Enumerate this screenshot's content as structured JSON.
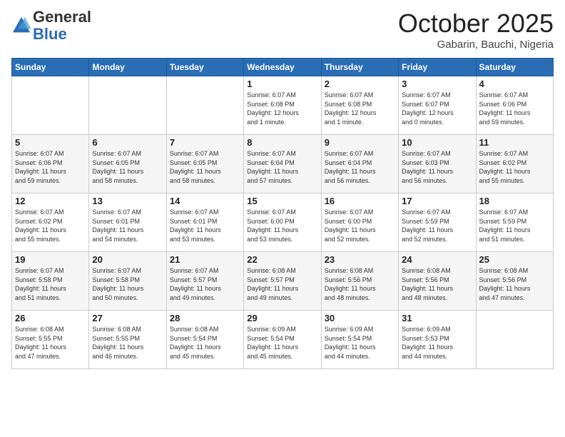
{
  "header": {
    "logo_general": "General",
    "logo_blue": "Blue",
    "month": "October 2025",
    "location": "Gabarin, Bauchi, Nigeria"
  },
  "weekdays": [
    "Sunday",
    "Monday",
    "Tuesday",
    "Wednesday",
    "Thursday",
    "Friday",
    "Saturday"
  ],
  "weeks": [
    [
      {
        "day": "",
        "info": ""
      },
      {
        "day": "",
        "info": ""
      },
      {
        "day": "",
        "info": ""
      },
      {
        "day": "1",
        "info": "Sunrise: 6:07 AM\nSunset: 6:08 PM\nDaylight: 12 hours\nand 1 minute."
      },
      {
        "day": "2",
        "info": "Sunrise: 6:07 AM\nSunset: 6:08 PM\nDaylight: 12 hours\nand 1 minute."
      },
      {
        "day": "3",
        "info": "Sunrise: 6:07 AM\nSunset: 6:07 PM\nDaylight: 12 hours\nand 0 minutes."
      },
      {
        "day": "4",
        "info": "Sunrise: 6:07 AM\nSunset: 6:06 PM\nDaylight: 11 hours\nand 59 minutes."
      }
    ],
    [
      {
        "day": "5",
        "info": "Sunrise: 6:07 AM\nSunset: 6:06 PM\nDaylight: 11 hours\nand 59 minutes."
      },
      {
        "day": "6",
        "info": "Sunrise: 6:07 AM\nSunset: 6:05 PM\nDaylight: 11 hours\nand 58 minutes."
      },
      {
        "day": "7",
        "info": "Sunrise: 6:07 AM\nSunset: 6:05 PM\nDaylight: 11 hours\nand 58 minutes."
      },
      {
        "day": "8",
        "info": "Sunrise: 6:07 AM\nSunset: 6:04 PM\nDaylight: 11 hours\nand 57 minutes."
      },
      {
        "day": "9",
        "info": "Sunrise: 6:07 AM\nSunset: 6:04 PM\nDaylight: 11 hours\nand 56 minutes."
      },
      {
        "day": "10",
        "info": "Sunrise: 6:07 AM\nSunset: 6:03 PM\nDaylight: 11 hours\nand 56 minutes."
      },
      {
        "day": "11",
        "info": "Sunrise: 6:07 AM\nSunset: 6:02 PM\nDaylight: 11 hours\nand 55 minutes."
      }
    ],
    [
      {
        "day": "12",
        "info": "Sunrise: 6:07 AM\nSunset: 6:02 PM\nDaylight: 11 hours\nand 55 minutes."
      },
      {
        "day": "13",
        "info": "Sunrise: 6:07 AM\nSunset: 6:01 PM\nDaylight: 11 hours\nand 54 minutes."
      },
      {
        "day": "14",
        "info": "Sunrise: 6:07 AM\nSunset: 6:01 PM\nDaylight: 11 hours\nand 53 minutes."
      },
      {
        "day": "15",
        "info": "Sunrise: 6:07 AM\nSunset: 6:00 PM\nDaylight: 11 hours\nand 53 minutes."
      },
      {
        "day": "16",
        "info": "Sunrise: 6:07 AM\nSunset: 6:00 PM\nDaylight: 11 hours\nand 52 minutes."
      },
      {
        "day": "17",
        "info": "Sunrise: 6:07 AM\nSunset: 5:59 PM\nDaylight: 11 hours\nand 52 minutes."
      },
      {
        "day": "18",
        "info": "Sunrise: 6:07 AM\nSunset: 5:59 PM\nDaylight: 11 hours\nand 51 minutes."
      }
    ],
    [
      {
        "day": "19",
        "info": "Sunrise: 6:07 AM\nSunset: 5:58 PM\nDaylight: 11 hours\nand 51 minutes."
      },
      {
        "day": "20",
        "info": "Sunrise: 6:07 AM\nSunset: 5:58 PM\nDaylight: 11 hours\nand 50 minutes."
      },
      {
        "day": "21",
        "info": "Sunrise: 6:07 AM\nSunset: 5:57 PM\nDaylight: 11 hours\nand 49 minutes."
      },
      {
        "day": "22",
        "info": "Sunrise: 6:08 AM\nSunset: 5:57 PM\nDaylight: 11 hours\nand 49 minutes."
      },
      {
        "day": "23",
        "info": "Sunrise: 6:08 AM\nSunset: 5:56 PM\nDaylight: 11 hours\nand 48 minutes."
      },
      {
        "day": "24",
        "info": "Sunrise: 6:08 AM\nSunset: 5:56 PM\nDaylight: 11 hours\nand 48 minutes."
      },
      {
        "day": "25",
        "info": "Sunrise: 6:08 AM\nSunset: 5:56 PM\nDaylight: 11 hours\nand 47 minutes."
      }
    ],
    [
      {
        "day": "26",
        "info": "Sunrise: 6:08 AM\nSunset: 5:55 PM\nDaylight: 11 hours\nand 47 minutes."
      },
      {
        "day": "27",
        "info": "Sunrise: 6:08 AM\nSunset: 5:55 PM\nDaylight: 11 hours\nand 46 minutes."
      },
      {
        "day": "28",
        "info": "Sunrise: 6:08 AM\nSunset: 5:54 PM\nDaylight: 11 hours\nand 45 minutes."
      },
      {
        "day": "29",
        "info": "Sunrise: 6:09 AM\nSunset: 5:54 PM\nDaylight: 11 hours\nand 45 minutes."
      },
      {
        "day": "30",
        "info": "Sunrise: 6:09 AM\nSunset: 5:54 PM\nDaylight: 11 hours\nand 44 minutes."
      },
      {
        "day": "31",
        "info": "Sunrise: 6:09 AM\nSunset: 5:53 PM\nDaylight: 11 hours\nand 44 minutes."
      },
      {
        "day": "",
        "info": ""
      }
    ]
  ]
}
